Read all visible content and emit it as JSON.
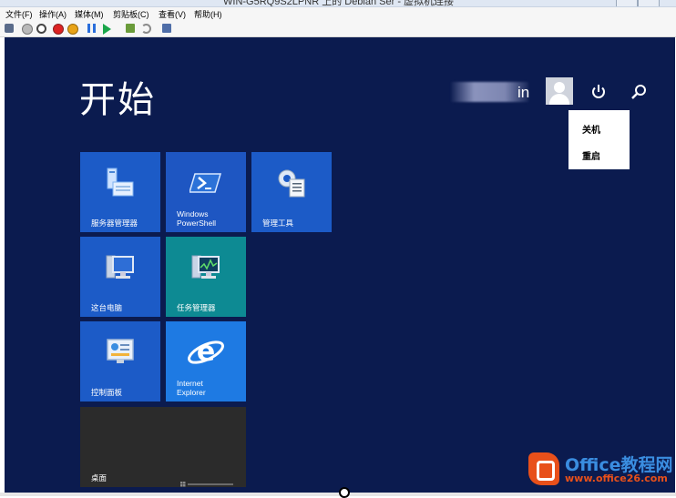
{
  "window": {
    "title": "WIN-G5RQ9S2LPNR 上的 Debian Ser - 虚拟机连接"
  },
  "menubar": {
    "items": [
      "文件(F)",
      "操作(A)",
      "媒体(M)",
      "剪贴板(C)",
      "查看(V)",
      "帮助(H)"
    ]
  },
  "toolbar": {
    "buttons": [
      "ctrl-alt-del-icon",
      "start-icon",
      "turnoff-icon",
      "shutdown-icon",
      "save-icon",
      "pause-icon",
      "resume-icon",
      "checkpoint-icon",
      "revert-icon",
      "enhanced-session-icon"
    ]
  },
  "start_screen": {
    "title": "开始",
    "user_name_visible": "in",
    "power_menu": {
      "items": [
        "关机",
        "重启"
      ]
    }
  },
  "tiles": [
    {
      "label": "服务器管理器",
      "color": "#1c5bc7",
      "icon": "server-manager-icon"
    },
    {
      "label": "Windows\nPowerShell",
      "color": "#1e56c2",
      "icon": "powershell-icon"
    },
    {
      "label": "管理工具",
      "color": "#1c5bc7",
      "icon": "admin-tools-icon"
    },
    {
      "label": "这台电脑",
      "color": "#1c5bc7",
      "icon": "computer-icon"
    },
    {
      "label": "任务管理器",
      "color": "#0d8a93",
      "icon": "task-manager-icon"
    },
    {
      "label": "控制面板",
      "color": "#1c5bc7",
      "icon": "control-panel-icon"
    },
    {
      "label": "Internet\nExplorer",
      "color": "#1e7ae3",
      "icon": "ie-icon"
    },
    {
      "label": "桌面",
      "color": "#2b2b2b",
      "icon": "desktop-icon"
    }
  ],
  "watermark": {
    "line1": "Office教程网",
    "line2": "www.office26.com"
  }
}
